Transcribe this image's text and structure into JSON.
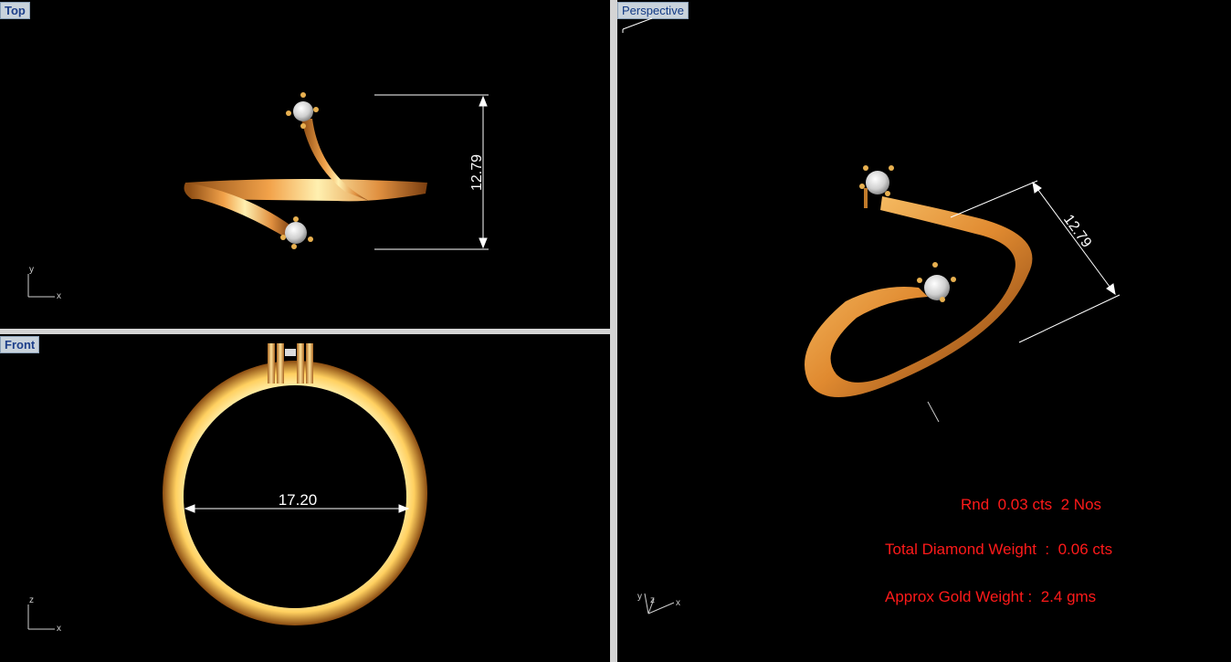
{
  "viewports": {
    "top": {
      "label": "Top",
      "dimension": "12.79",
      "axis_x": "x",
      "axis_y": "y"
    },
    "front": {
      "label": "Front",
      "dimension": "17.20",
      "axis_x": "x",
      "axis_y": "z"
    },
    "perspective": {
      "label": "Perspective",
      "dimension": "12.79",
      "axis_x": "x",
      "axis_y": "y",
      "axis_z": "z"
    }
  },
  "info": {
    "stone": "Rnd  0.03 cts  2 Nos",
    "total_diamond": "Total Diamond Weight  :  0.06 cts",
    "gold_weight": "Approx Gold Weight :  2.4 gms"
  },
  "colors": {
    "gold": "#e0a040",
    "gold_light": "#ffe9a0",
    "annotation": "#ff1a1a",
    "label_bg": "#c9d3dc"
  }
}
